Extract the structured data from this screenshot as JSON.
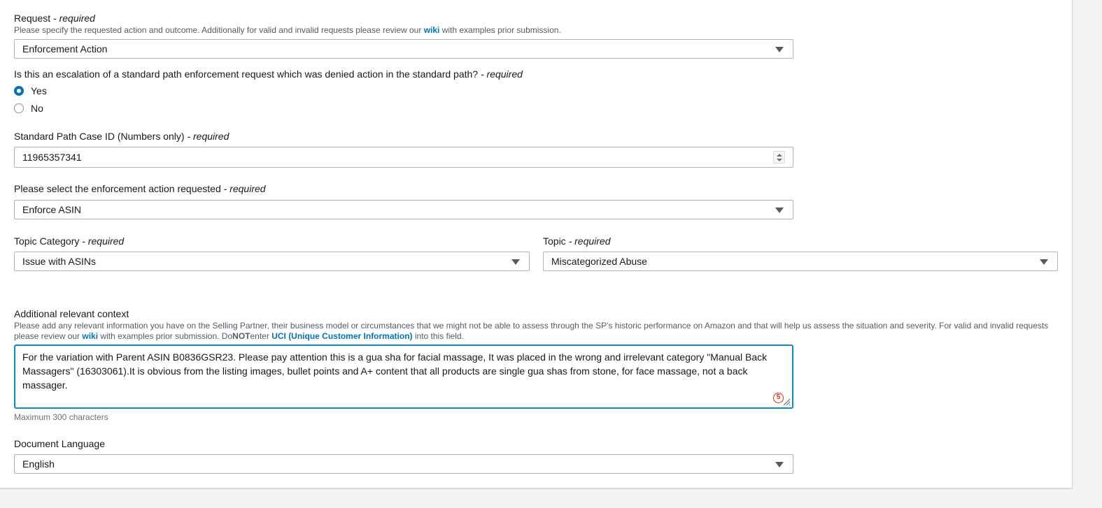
{
  "request": {
    "label": "Request",
    "req": " - required",
    "desc_pre": "Please specify the requested action and outcome. Additionally for valid and invalid requests please review our ",
    "wiki": "wiki",
    "desc_post": " with examples prior submission.",
    "value": "Enforcement Action"
  },
  "escalation": {
    "label": "Is this an escalation of a standard path enforcement request which was denied action in the standard path?",
    "req": " - required",
    "options": [
      "Yes",
      "No"
    ],
    "selected": "Yes"
  },
  "case_id": {
    "label": "Standard Path Case ID (Numbers only)",
    "req": " - required",
    "value": "11965357341"
  },
  "action": {
    "label": "Please select the enforcement action requested",
    "req": " - required",
    "value": "Enforce ASIN"
  },
  "topic_category": {
    "label": "Topic Category",
    "req": " - required",
    "value": "Issue with ASINs"
  },
  "topic": {
    "label": "Topic",
    "req": " - required",
    "value": "Miscategorized Abuse"
  },
  "context": {
    "label": "Additional relevant context",
    "desc_pre": "Please add any relevant information you have on the Selling Partner, their business model or circumstances that we might not be able to assess through the SP's historic performance on Amazon and that will help us assess the situation and severity. For valid and invalid requests please review our ",
    "wiki": "wiki",
    "desc_mid": " with examples prior submission. Do",
    "not": "NOT",
    "desc_mid2": "enter ",
    "uci": "UCI (Unique Customer Information)",
    "desc_post": " into this field.",
    "value": "For the variation with Parent ASIN B0836GSR23. Please pay attention this is a gua sha for facial massage, It was placed in the wrong and irrelevant category \"Manual Back Massagers\" (16303061).It is obvious from the listing images, bullet points and A+ content that all products are single gua shas from stone, for face massage, not a back massager.",
    "counter": "5",
    "hint": "Maximum 300 characters"
  },
  "language": {
    "label": "Document Language",
    "value": "English"
  },
  "colors": {
    "accent": "#0073bb",
    "focus_border": "#0a8bc7",
    "error": "#d13212"
  }
}
